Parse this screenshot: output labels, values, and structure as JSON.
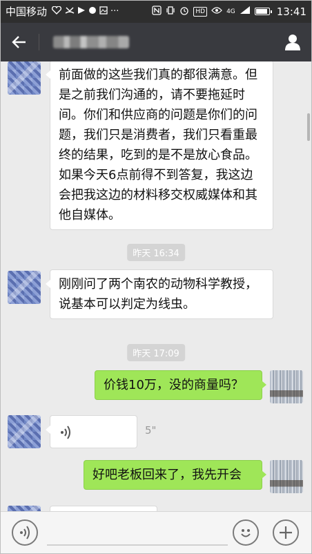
{
  "status_bar": {
    "carrier": "中国移动",
    "more": "···",
    "hd": "HD",
    "network": "4G",
    "time": "13:41"
  },
  "header": {
    "back_icon": "arrow-left-icon",
    "profile_icon": "person-icon"
  },
  "messages": [
    {
      "side": "left",
      "text": "前面做的这些我们真的都很满意。但是之前我们沟通的，请不要拖延时间。你们和供应商的问题是你们的问题，我们只是消费者，我们只看重最终的结果，吃到的是不是放心食品。如果今天6点前得不到答复，我这边会把我这边的材料移交权威媒体和其他自媒体。"
    },
    {
      "type": "timestamp",
      "text": "昨天 16:34"
    },
    {
      "side": "left",
      "text": "刚刚问了两个南农的动物科学教授，说基本可以判定为线虫。"
    },
    {
      "type": "timestamp",
      "text": "昨天 17:09"
    },
    {
      "side": "right",
      "text": "价钱10万，没的商量吗？"
    },
    {
      "side": "left",
      "type": "voice",
      "duration": "5\""
    },
    {
      "side": "right",
      "text": "好吧老板回来了，我先开会"
    }
  ],
  "input_bar": {
    "voice_icon": "voice-icon",
    "emoji_icon": "emoji-icon",
    "plus_icon": "plus-icon"
  },
  "colors": {
    "header_bg": "#393a3f",
    "status_bg": "#2e2e2e",
    "chat_bg": "#ebebeb",
    "my_bubble": "#9fe658"
  }
}
